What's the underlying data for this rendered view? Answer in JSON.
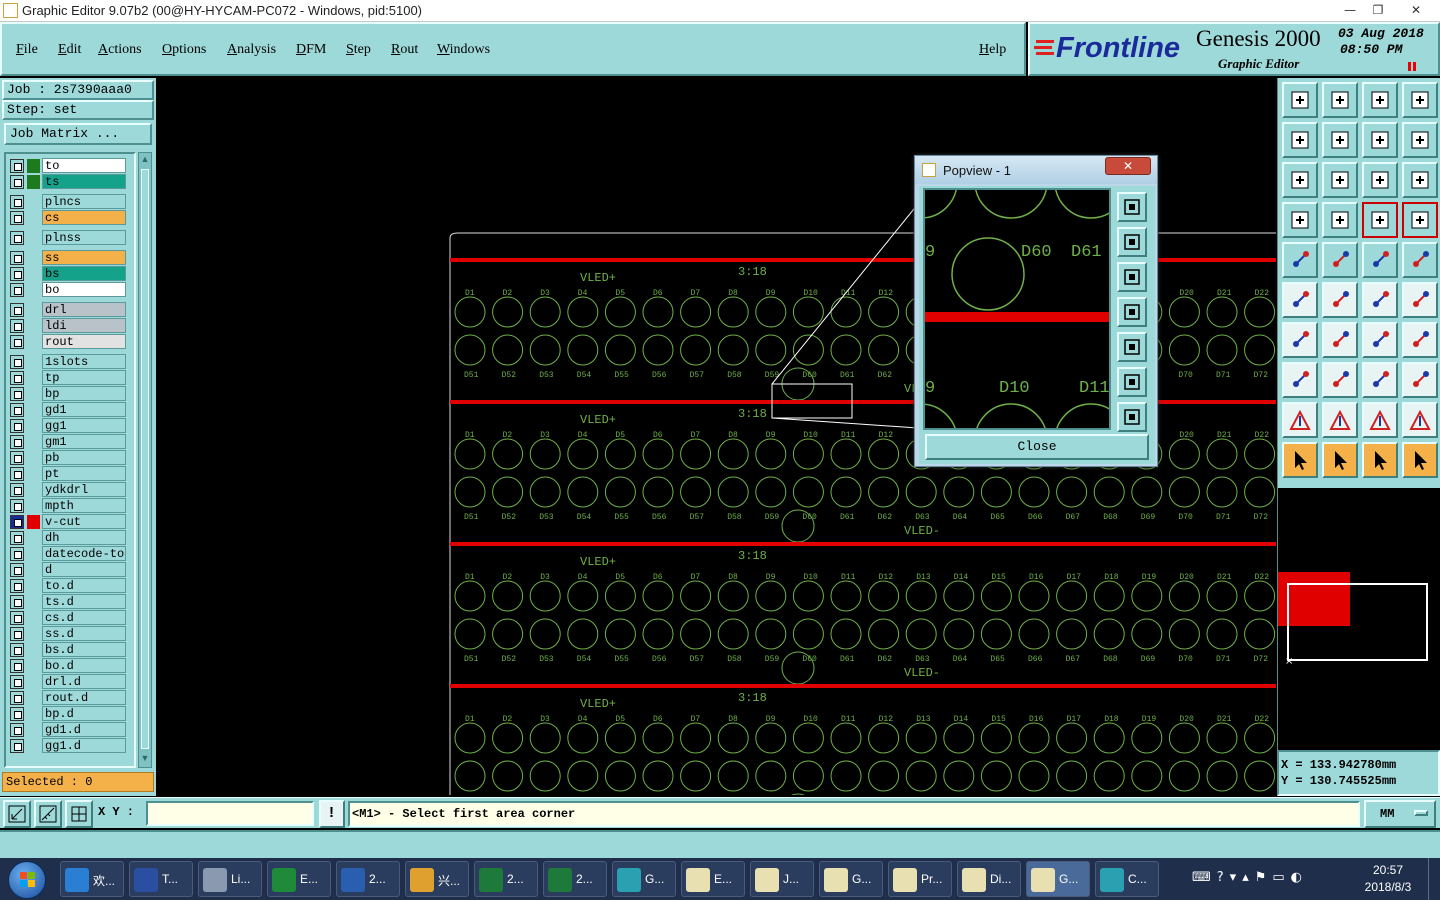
{
  "window": {
    "title": "Graphic Editor 9.07b2 (00@HY-HYCAM-PC072 - Windows, pid:5100)",
    "controls": [
      "—",
      "❐",
      "✕"
    ]
  },
  "menu": {
    "items": [
      "File",
      "Edit",
      "Actions",
      "Options",
      "Analysis",
      "DFM",
      "Step",
      "Rout",
      "Windows"
    ],
    "help": "Help"
  },
  "branding": {
    "logo": "Frontline",
    "product": "Genesis 2000",
    "subtitle": "Graphic Editor",
    "date": "03 Aug 2018",
    "time": "08:50 PM"
  },
  "job": {
    "job_label": "Job : 2s7390aaa0",
    "step_label": "Step: set",
    "matrix_button": "Job Matrix ..."
  },
  "layers": [
    {
      "name": "to",
      "color": "#1e7a1e",
      "bg": "#ffffff"
    },
    {
      "name": "ts",
      "color": "#1e7a1e",
      "bg": "#14a38a"
    },
    {
      "name": "plncs",
      "color": "",
      "bg": "#9ed9d9"
    },
    {
      "name": "cs",
      "color": "",
      "bg": "#f4b14a"
    },
    {
      "name": "plnss",
      "color": "",
      "bg": "#9ed9d9"
    },
    {
      "name": "ss",
      "color": "",
      "bg": "#f4b14a"
    },
    {
      "name": "bs",
      "color": "",
      "bg": "#14a38a"
    },
    {
      "name": "bo",
      "color": "",
      "bg": "#ffffff"
    },
    {
      "name": "drl",
      "color": "",
      "bg": "#b9c2c8"
    },
    {
      "name": "ldi",
      "color": "",
      "bg": "#b9c2c8"
    },
    {
      "name": "rout",
      "color": "",
      "bg": "#e2e2e2"
    },
    {
      "name": "1slots",
      "color": "",
      "bg": "#9ed9d9"
    },
    {
      "name": "tp",
      "color": "",
      "bg": "#9ed9d9"
    },
    {
      "name": "bp",
      "color": "",
      "bg": "#9ed9d9"
    },
    {
      "name": "gd1",
      "color": "",
      "bg": "#9ed9d9"
    },
    {
      "name": "gg1",
      "color": "",
      "bg": "#9ed9d9"
    },
    {
      "name": "gm1",
      "color": "",
      "bg": "#9ed9d9"
    },
    {
      "name": "pb",
      "color": "",
      "bg": "#9ed9d9"
    },
    {
      "name": "pt",
      "color": "",
      "bg": "#9ed9d9"
    },
    {
      "name": "ydkdrl",
      "color": "",
      "bg": "#9ed9d9"
    },
    {
      "name": "mpth",
      "color": "",
      "bg": "#9ed9d9"
    },
    {
      "name": "v-cut",
      "color": "#e00000",
      "bg": "#9ed9d9",
      "selected": true
    },
    {
      "name": "dh",
      "color": "",
      "bg": "#9ed9d9"
    },
    {
      "name": "datecode-to",
      "color": "",
      "bg": "#9ed9d9"
    },
    {
      "name": "d",
      "color": "",
      "bg": "#9ed9d9"
    },
    {
      "name": "to.d",
      "color": "",
      "bg": "#9ed9d9"
    },
    {
      "name": "ts.d",
      "color": "",
      "bg": "#9ed9d9"
    },
    {
      "name": "cs.d",
      "color": "",
      "bg": "#9ed9d9"
    },
    {
      "name": "ss.d",
      "color": "",
      "bg": "#9ed9d9"
    },
    {
      "name": "bs.d",
      "color": "",
      "bg": "#9ed9d9"
    },
    {
      "name": "bo.d",
      "color": "",
      "bg": "#9ed9d9"
    },
    {
      "name": "drl.d",
      "color": "",
      "bg": "#9ed9d9"
    },
    {
      "name": "rout.d",
      "color": "",
      "bg": "#9ed9d9"
    },
    {
      "name": "bp.d",
      "color": "",
      "bg": "#9ed9d9"
    },
    {
      "name": "gd1.d",
      "color": "",
      "bg": "#9ed9d9"
    },
    {
      "name": "gg1.d",
      "color": "",
      "bg": "#9ed9d9"
    }
  ],
  "selected": "Selected : 0",
  "popview": {
    "title": "Popview - 1",
    "labels": [
      "9",
      "D60",
      "D61",
      "9",
      "D10",
      "D11"
    ],
    "close_button": "Close"
  },
  "canvas": {
    "row_label": "VLED+",
    "row_label_bottom": "VLED-",
    "code": "3:18",
    "top_labels": [
      "D1",
      "D2",
      "D3",
      "D4",
      "D5",
      "D6",
      "D7",
      "D8",
      "D9",
      "D10",
      "D11",
      "D12",
      "D13",
      "D14",
      "D15",
      "D16",
      "D17",
      "D18",
      "D19",
      "D20",
      "D21",
      "D22"
    ],
    "bottom_labels": [
      "D51",
      "D52",
      "D53",
      "D54",
      "D55",
      "D56",
      "D57",
      "D58",
      "D59",
      "D60",
      "D61",
      "D62",
      "D63",
      "D64",
      "D65",
      "D66",
      "D67",
      "D68",
      "D69",
      "D70",
      "D71",
      "D72"
    ]
  },
  "coords": {
    "x": "X  =  133.942780mm",
    "y": "Y  =  130.745525mm"
  },
  "bottom": {
    "xy_label": "X Y :",
    "xy_value": "",
    "message": "<M1> - Select first area corner",
    "units": "MM"
  },
  "taskbar": {
    "items": [
      {
        "label": "欢...",
        "color": "#2a7fd4"
      },
      {
        "label": "T...",
        "color": "#2a4fa0"
      },
      {
        "label": "Li...",
        "color": "#8a98b0"
      },
      {
        "label": "E...",
        "color": "#1e8a3a"
      },
      {
        "label": "2...",
        "color": "#2a5fb0"
      },
      {
        "label": "兴...",
        "color": "#e0a030"
      },
      {
        "label": "2...",
        "color": "#1e7a3a"
      },
      {
        "label": "2...",
        "color": "#1e7a3a"
      },
      {
        "label": "G...",
        "color": "#2aa0b0"
      },
      {
        "label": "E...",
        "color": "#e8e0b0"
      },
      {
        "label": "J...",
        "color": "#e8e0b0"
      },
      {
        "label": "G...",
        "color": "#e8e0b0"
      },
      {
        "label": "Pr...",
        "color": "#e8e0b0"
      },
      {
        "label": "Di...",
        "color": "#e8e0b0"
      },
      {
        "label": "G...",
        "color": "#e8e0b0"
      },
      {
        "label": "C...",
        "color": "#2aa0b0"
      }
    ],
    "time": "20:57",
    "date": "2018/8/3"
  }
}
